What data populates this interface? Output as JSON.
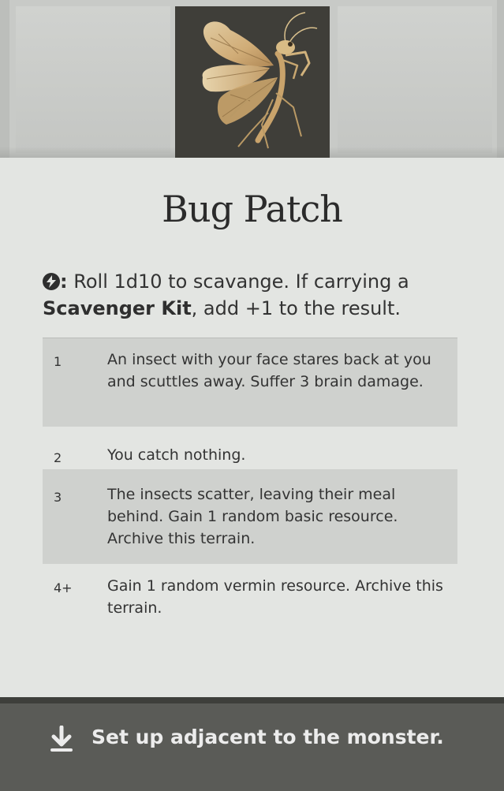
{
  "card": {
    "title": "Bug Patch",
    "art_icon": "mantis-insect-illustration",
    "intro": {
      "action_icon": "lightning-bolt-icon",
      "colon": ":",
      "text_before": "Roll 1d10 to scavange. If carrying a",
      "bold_item": "Scavenger Kit",
      "text_after": ", add +1 to the result."
    },
    "outcomes": [
      {
        "roll": "1",
        "text": "An insect with your face stares back at you and scuttles away. Suffer 3 brain damage."
      },
      {
        "roll": "2",
        "text": "You catch nothing."
      },
      {
        "roll": "3",
        "text": "The insects scatter, leaving their meal behind. Gain 1 random basic resource. Archive this terrain."
      },
      {
        "roll": "4+",
        "text": "Gain 1 random vermin resource. Archive this terrain."
      }
    ],
    "footer": {
      "icon": "download-arrow-icon",
      "text": "Set up adjacent to the monster."
    },
    "colors": {
      "card_background": "#e3e5e2",
      "row_shade": "#cfd1ce",
      "footer_background": "#5a5b57",
      "art_background": "#3f3e39"
    }
  }
}
